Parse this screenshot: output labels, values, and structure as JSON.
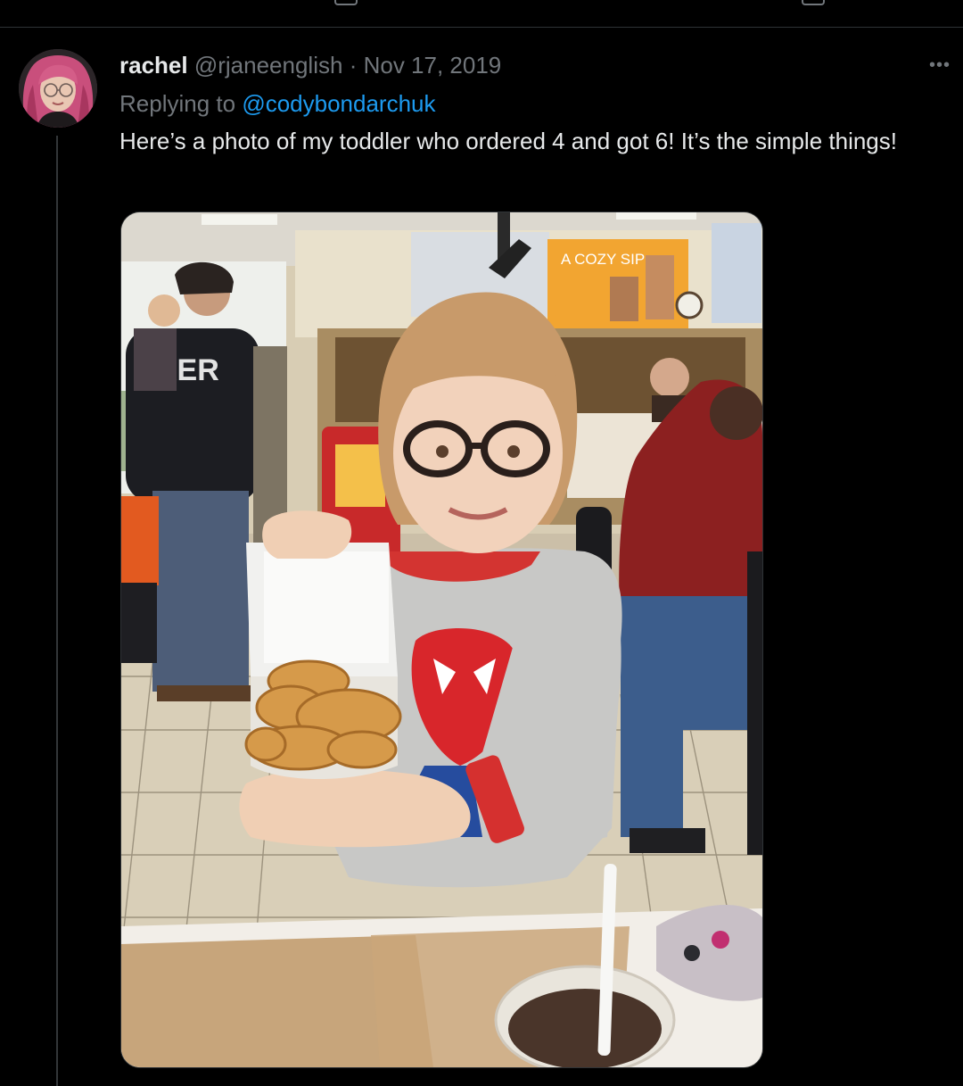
{
  "tweet": {
    "author_name": "rachel",
    "author_handle": "@rjaneenglish",
    "separator": "·",
    "date": "Nov 17, 2019",
    "replying_prefix": "Replying to",
    "replying_to": "@codybondarchuk",
    "text": "Here’s a photo of my toddler who ordered 4 and got 6! It’s the simple things!",
    "more_label": "•••"
  },
  "photo": {
    "description_icon": "attached-photo",
    "sign_text": "A COZY SIP"
  },
  "colors": {
    "background": "#000000",
    "text_primary": "#e7e9ea",
    "text_secondary": "#71767b",
    "link": "#1d9bf0",
    "border": "#2f3336"
  }
}
